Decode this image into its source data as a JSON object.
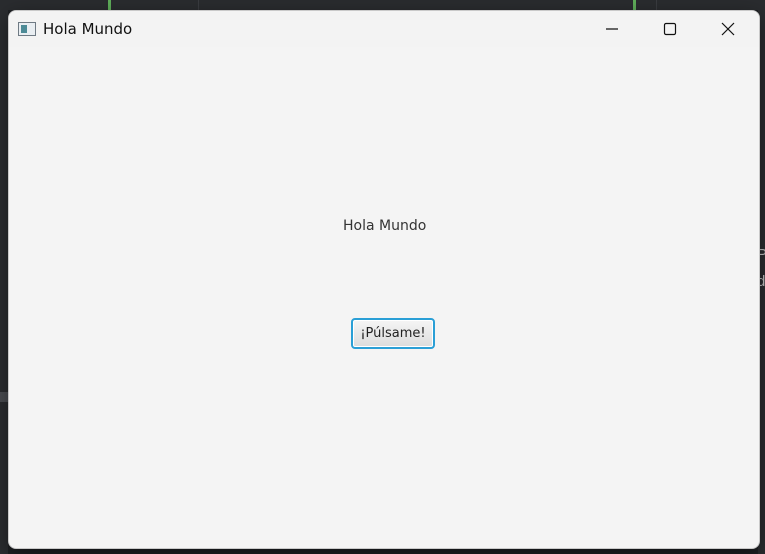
{
  "window": {
    "title": "Hola Mundo",
    "icons": {
      "app": "app-window-icon",
      "minimize": "minimize-icon",
      "maximize": "maximize-icon",
      "close": "close-icon"
    }
  },
  "content": {
    "label": "Hola Mundo",
    "button_label": "¡Púlsame!"
  },
  "background": {
    "right_edge_text": [
      "P",
      "d"
    ]
  },
  "colors": {
    "window_bg": "#f4f4f4",
    "button_focus_border": "#2a9fd6",
    "desktop_bg": "#1f2124",
    "accent_green": "#5fae5a"
  }
}
